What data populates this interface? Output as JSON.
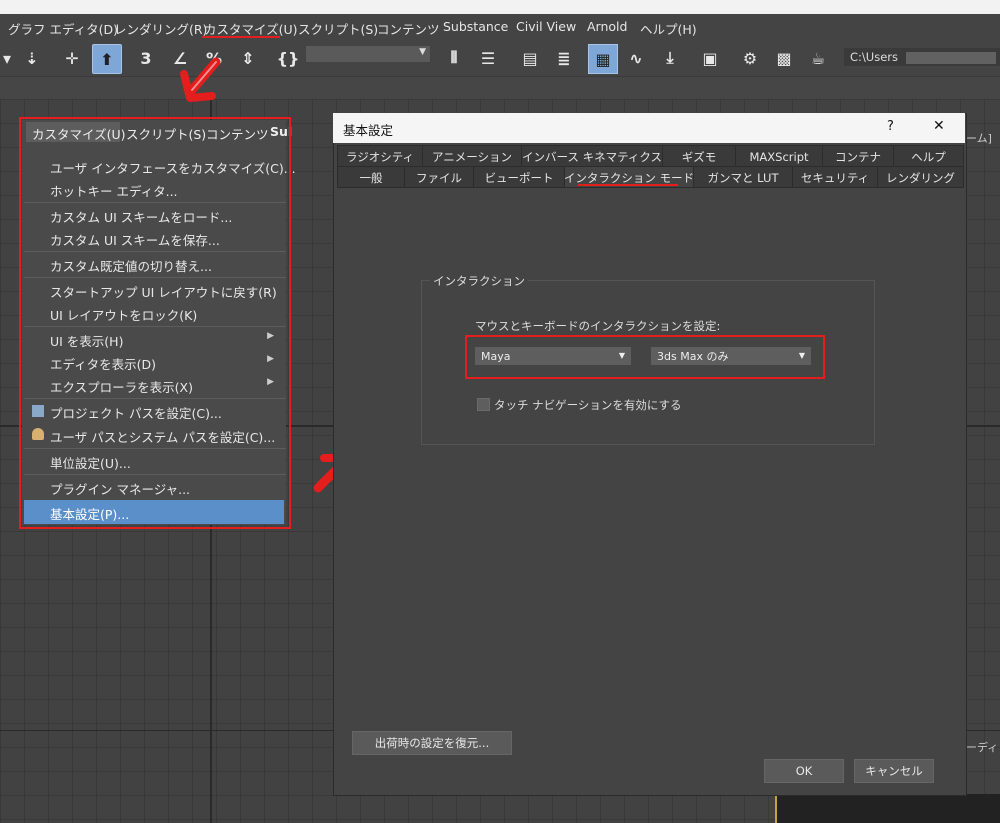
{
  "menubar": {
    "items": [
      "グラフ エディタ(D)",
      "レンダリング(R)",
      "カスタマイズ(U)",
      "スクリプト(S)",
      "コンテンツ",
      "Substance",
      "Civil View",
      "Arnold",
      "ヘルプ(H)"
    ]
  },
  "toolbar": {
    "path": "C:\\Users",
    "dropdown_value": ""
  },
  "customize_menu": {
    "bar_items": [
      "カスタマイズ(U)",
      "スクリプト(S)",
      "コンテンツ",
      "Sul"
    ],
    "items": [
      {
        "label": "ユーザ インタフェースをカスタマイズ(C)..."
      },
      {
        "label": "ホットキー エディタ..."
      },
      {
        "label": "カスタム UI スキームをロード..."
      },
      {
        "label": "カスタム UI スキームを保存..."
      },
      {
        "label": "カスタム既定値の切り替え..."
      },
      {
        "label": "スタートアップ UI レイアウトに戻す(R)"
      },
      {
        "label": "UI レイアウトをロック(K)"
      },
      {
        "label": "UI を表示(H)"
      },
      {
        "label": "エディタを表示(D)"
      },
      {
        "label": "エクスプローラを表示(X)"
      },
      {
        "label": "プロジェクト パスを設定(C)..."
      },
      {
        "label": "ユーザ パスとシステム パスを設定(C)..."
      },
      {
        "label": "単位設定(U)..."
      },
      {
        "label": "プラグイン マネージャ..."
      },
      {
        "label": "基本設定(P)..."
      }
    ]
  },
  "dialog": {
    "title": "基本設定",
    "help": "?",
    "close": "✕",
    "tabs_row1": [
      "ラジオシティ",
      "アニメーション",
      "インバース キネマティクス",
      "ギズモ",
      "MAXScript",
      "コンテナ",
      "ヘルプ"
    ],
    "tabs_row2": [
      "一般",
      "ファイル",
      "ビューポート",
      "インタラクション モード",
      "ガンマと LUT",
      "セキュリティ",
      "レンダリング"
    ],
    "group_title": "インタラクション",
    "mouse_label": "マウスとキーボードのインタラクションを設定:",
    "dropdown1": "Maya",
    "dropdown2": "3ds Max のみ",
    "touch_label": "タッチ ナビゲーションを有効にする",
    "restore_button": "出荷時の設定を復元...",
    "ok_button": "OK",
    "cancel_button": "キャンセル"
  },
  "side_text": {
    "right1": "ーム]",
    "right2": "ーディ"
  },
  "colors": {
    "accent_red": "#e41d1d",
    "highlight_blue": "#5b8fc9"
  }
}
